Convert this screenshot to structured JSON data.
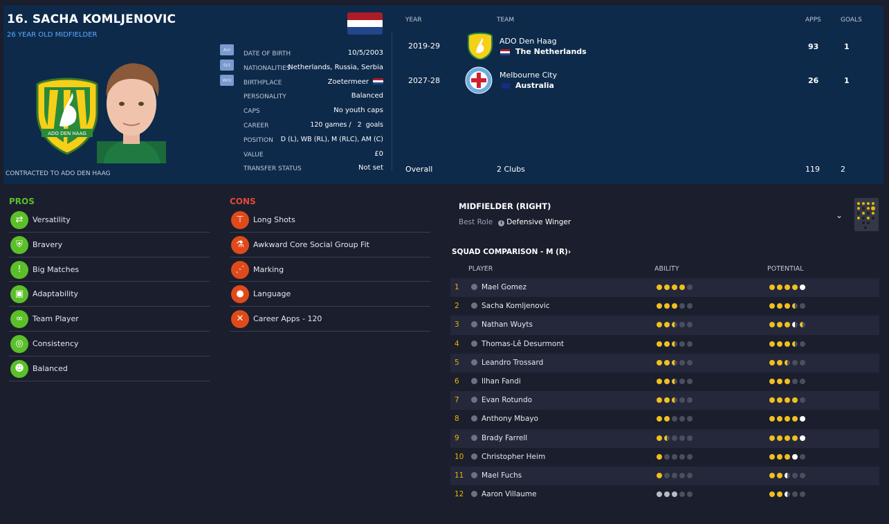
{
  "player": {
    "title": "16. SACHA KOMLJENOVIC",
    "subtitle": "26 YEAR OLD MIDFIELDER",
    "contract": "CONTRACTED TO ADO DEN HAAG",
    "club_crest_text": "ADO DEN HAAG"
  },
  "attr_badges": [
    "Anl",
    "Sct",
    "Wnt"
  ],
  "info": [
    {
      "key": "DATE OF BIRTH",
      "value": "10/5/2003"
    },
    {
      "key": "NATIONALITIES",
      "value": "Netherlands, Russia, Serbia"
    },
    {
      "key": "BIRTHPLACE",
      "value": "Zoetermeer"
    },
    {
      "key": "PERSONALITY",
      "value": "Balanced"
    },
    {
      "key": "CAPS",
      "value": "No youth caps"
    },
    {
      "key": "CAREER",
      "value": "120 games /   2  goals"
    },
    {
      "key": "POSITION",
      "value": "D (L), WB (RL), M (RLC), AM (C)"
    },
    {
      "key": "VALUE",
      "value": "£0"
    },
    {
      "key": "TRANSFER STATUS",
      "value": "Not set"
    }
  ],
  "history": {
    "headers": {
      "year": "YEAR",
      "team": "TEAM",
      "apps": "APPS",
      "goals": "GOALS"
    },
    "rows": [
      {
        "year": "2019-29",
        "club": "ADO Den Haag",
        "nation": "The Netherlands",
        "apps": "93",
        "goals": "1"
      },
      {
        "year": "2027-28",
        "club": "Melbourne City",
        "nation": "Australia",
        "apps": "26",
        "goals": "1"
      }
    ],
    "total": {
      "label": "Overall",
      "clubs": "2 Clubs",
      "apps": "119",
      "goals": "2"
    }
  },
  "pros": {
    "title": "PROS",
    "items": [
      "Versatility",
      "Bravery",
      "Big Matches",
      "Adaptability",
      "Team Player",
      "Consistency",
      "Balanced"
    ]
  },
  "cons": {
    "title": "CONS",
    "items": [
      "Long Shots",
      "Awkward Core Social Group Fit",
      "Marking",
      "Language",
      "Career Apps - 120"
    ]
  },
  "position": {
    "title": "MIDFIELDER (RIGHT)",
    "best_role_label": "Best Role",
    "best_role": "Defensive Winger"
  },
  "squad": {
    "title": "SQUAD COMPARISON - M (R)",
    "chevron": "›",
    "headers": {
      "player": "PLAYER",
      "ability": "ABILITY",
      "potential": "POTENTIAL"
    },
    "rows": [
      {
        "n": "1",
        "name": "Mael Gomez",
        "ability": 4,
        "potential": 5
      },
      {
        "n": "2",
        "name": "Sacha Komljenovic",
        "ability": 3,
        "potential": 3.5
      },
      {
        "n": "3",
        "name": "Nathan Wuyts",
        "ability": 2.5,
        "potential": 4.5
      },
      {
        "n": "4",
        "name": "Thomas-Lê Desurmont",
        "ability": 2.5,
        "potential": 3.5
      },
      {
        "n": "5",
        "name": "Leandro Trossard",
        "ability": 2.5,
        "potential": 2.5
      },
      {
        "n": "6",
        "name": "Ilhan Fandi",
        "ability": 2.5,
        "potential": 3
      },
      {
        "n": "7",
        "name": "Evan Rotundo",
        "ability": 2.5,
        "potential": 4
      },
      {
        "n": "8",
        "name": "Anthony Mbayo",
        "ability": 2,
        "potential": 5
      },
      {
        "n": "9",
        "name": "Brady Farrell",
        "ability": 1.5,
        "potential": 5
      },
      {
        "n": "10",
        "name": "Christopher Heim",
        "ability": 1,
        "potential": 4
      },
      {
        "n": "11",
        "name": "Mael Fuchs",
        "ability": 1,
        "potential": 2.5
      },
      {
        "n": "12",
        "name": "Aaron Villaume",
        "ability": 3,
        "potential": 2.5
      }
    ]
  },
  "colors": {
    "accent": "#e8b600",
    "pros": "#5bbf2a",
    "cons": "#e04a1a",
    "header_bg": "#0e2a4a"
  }
}
